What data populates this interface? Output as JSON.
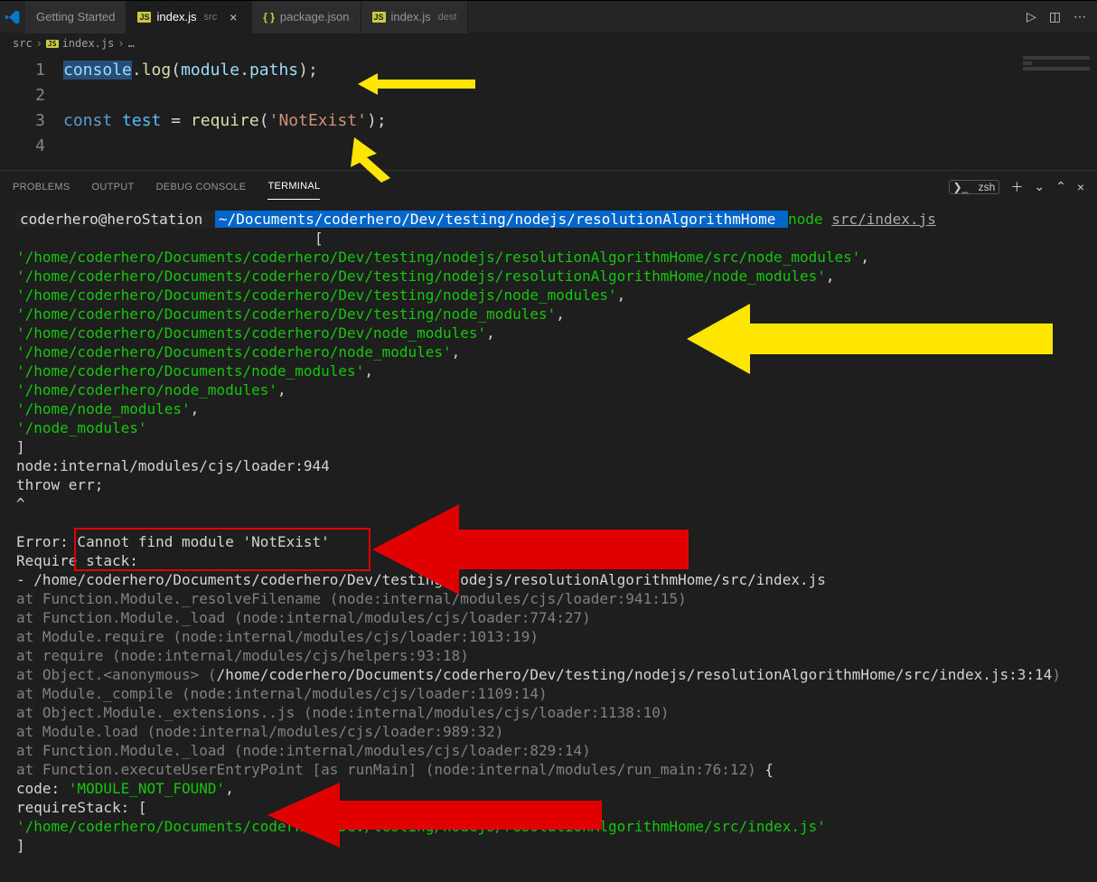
{
  "tabs": {
    "t0": {
      "label": "Getting Started"
    },
    "t1": {
      "label": "index.js",
      "sub": "src"
    },
    "t2": {
      "label": "package.json"
    },
    "t3": {
      "label": "index.js",
      "sub": "dest"
    }
  },
  "breadcrumb": {
    "p0": "src",
    "p1": "index.js",
    "p2": "…"
  },
  "editor": {
    "ln1": "1",
    "ln2": "2",
    "ln3": "3",
    "ln4": "4",
    "l1": {
      "a": "console",
      "b": ".",
      "c": "log",
      "d": "(",
      "e": "module",
      "f": ".",
      "g": "paths",
      "h": ");"
    },
    "l3": {
      "a": "const ",
      "b": "test",
      "c": " = ",
      "d": "require",
      "e": "(",
      "f": "'NotExist'",
      "g": ");"
    }
  },
  "panel": {
    "problems": "PROBLEMS",
    "output": "OUTPUT",
    "debug": "DEBUG CONSOLE",
    "terminal": "TERMINAL",
    "shell": "zsh"
  },
  "term": {
    "user": " coderhero@heroStation ",
    "path": "  ~/Documents/coderhero/Dev/testing/nodejs/resolutionAlgorithmHome ",
    "node": "node",
    "cmd": "src/index.js",
    "bracket_open": "[",
    "paths": {
      "p0": "'/home/coderhero/Documents/coderhero/Dev/testing/nodejs/resolutionAlgorithmHome/src/node_modules'",
      "p1": "'/home/coderhero/Documents/coderhero/Dev/testing/nodejs/resolutionAlgorithmHome/node_modules'",
      "p2": "'/home/coderhero/Documents/coderhero/Dev/testing/nodejs/node_modules'",
      "p3": "'/home/coderhero/Documents/coderhero/Dev/testing/node_modules'",
      "p4": "'/home/coderhero/Documents/coderhero/Dev/node_modules'",
      "p5": "'/home/coderhero/Documents/coderhero/node_modules'",
      "p6": "'/home/coderhero/Documents/node_modules'",
      "p7": "'/home/coderhero/node_modules'",
      "p8": "'/home/node_modules'",
      "p9": "'/node_modules'"
    },
    "bracket_close": "]",
    "loader1": "node:internal/modules/cjs/loader:944",
    "throw": "  throw err;",
    "caret": "  ^",
    "err_label": "Error:",
    "err_msg": " Cannot find module 'NotExist'",
    "req_stack": "Require stack:",
    "stack_top": "- /home/coderhero/Documents/coderhero/Dev/testing/nodejs/resolutionAlgorithmHome/src/index.js",
    "st1": "    at Function.Module._resolveFilename (node:internal/modules/cjs/loader:941:15)",
    "st2": "    at Function.Module._load (node:internal/modules/cjs/loader:774:27)",
    "st3": "    at Module.require (node:internal/modules/cjs/loader:1013:19)",
    "st4": "    at require (node:internal/modules/cjs/helpers:93:18)",
    "st5a": "    at Object.<anonymous> (",
    "st5b": "/home/coderhero/Documents/coderhero/Dev/testing/nodejs/resolutionAlgorithmHome/src/index.js:3:14",
    "st5c": ")",
    "st6": "    at Module._compile (node:internal/modules/cjs/loader:1109:14)",
    "st7": "    at Object.Module._extensions..js (node:internal/modules/cjs/loader:1138:10)",
    "st8": "    at Module.load (node:internal/modules/cjs/loader:989:32)",
    "st9": "    at Function.Module._load (node:internal/modules/cjs/loader:829:14)",
    "st10a": "    at Function.executeUserEntryPoint [as runMain] (node:internal/modules/run_main:76:12)",
    "st10b": " {",
    "code_label": "  code: ",
    "code_val": "'MODULE_NOT_FOUND'",
    "code_comma": ",",
    "reqstack_label": "  requireStack: [",
    "rs0": "    '/home/coderhero/Documents/coderhero/Dev/testing/nodejs/resolutionAlgorithmHome/src/index.js'",
    "rs_close": "  ]"
  }
}
